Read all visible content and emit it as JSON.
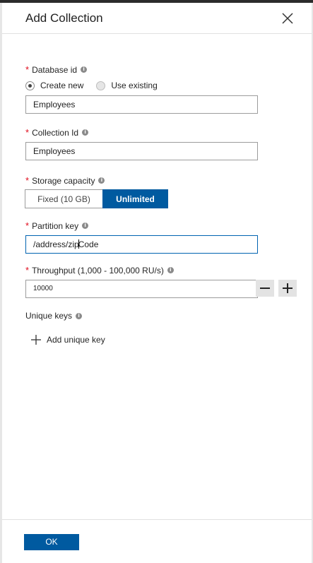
{
  "header": {
    "title": "Add Collection"
  },
  "database": {
    "label": "Database id",
    "options": [
      "Create new",
      "Use existing"
    ],
    "selected_option": "Create new",
    "value": "Employees"
  },
  "collection": {
    "label": "Collection Id",
    "value": "Employees"
  },
  "storage": {
    "label": "Storage capacity",
    "options": [
      "Fixed (10 GB)",
      "Unlimited"
    ],
    "selected": "Unlimited"
  },
  "partition": {
    "label": "Partition key",
    "value_before_caret": "/address/zip",
    "value_after_caret": "Code"
  },
  "throughput": {
    "label": "Throughput (1,000 - 100,000 RU/s)",
    "value": "10000"
  },
  "unique_keys": {
    "label": "Unique keys",
    "add_label": "Add unique key"
  },
  "footer": {
    "ok_label": "OK"
  },
  "required_marker": "*",
  "info_glyph": "i",
  "colors": {
    "accent": "#005aa0",
    "required": "#e00b1c"
  }
}
